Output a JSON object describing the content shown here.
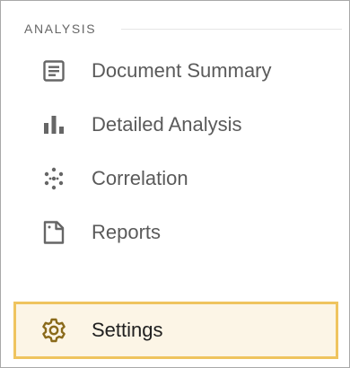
{
  "sidebar": {
    "section_title": "ANALYSIS",
    "items": [
      {
        "label": "Document Summary",
        "icon": "document-icon"
      },
      {
        "label": "Detailed Analysis",
        "icon": "bar-chart-icon"
      },
      {
        "label": "Correlation",
        "icon": "scatter-dots-icon"
      },
      {
        "label": "Reports",
        "icon": "report-page-icon"
      }
    ],
    "settings": {
      "label": "Settings",
      "icon": "gear-icon",
      "selected": true
    }
  },
  "colors": {
    "icon": "#666666",
    "text": "#5a5a5a",
    "active_bg": "#fcf5e6",
    "active_border": "#efc45f",
    "active_icon": "#8a6a1a",
    "active_text": "#202020"
  }
}
